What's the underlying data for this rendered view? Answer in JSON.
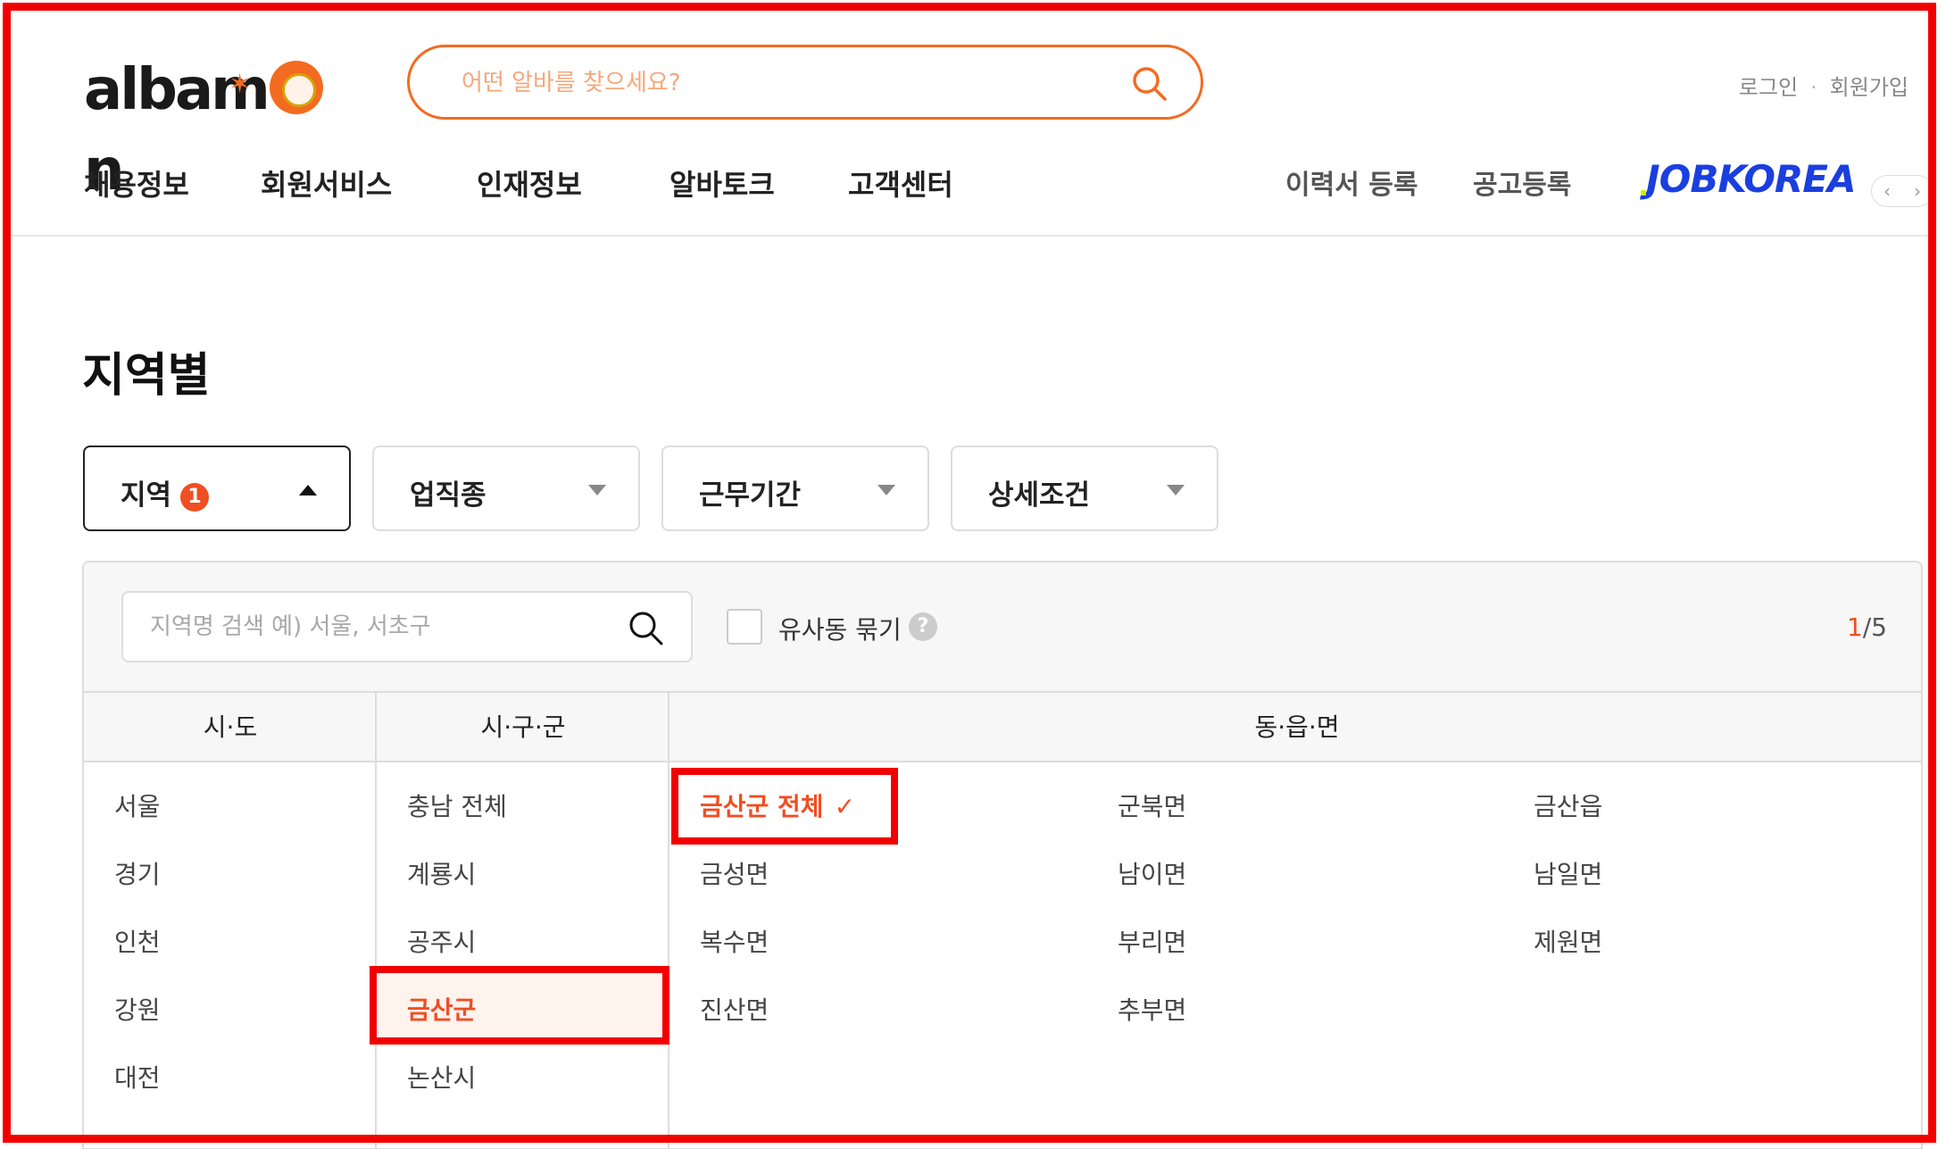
{
  "header": {
    "logo_text": "albamon",
    "search_placeholder": "어떤 알바를 찾으세요?",
    "auth": {
      "login": "로그인",
      "separator": "·",
      "signup": "회원가입"
    },
    "nav": [
      "채용정보",
      "회원서비스",
      "인재정보",
      "알바토크",
      "고객센터"
    ],
    "util": {
      "resume": "이력서 등록",
      "post": "공고등록"
    },
    "partner_logo": "JOBKOREA",
    "carousel": {
      "prev": "‹",
      "next": "›"
    }
  },
  "page_title": "지역별",
  "filters": [
    {
      "label": "지역",
      "badge": "1",
      "state": "open"
    },
    {
      "label": "업직종",
      "state": "closed"
    },
    {
      "label": "근무기간",
      "state": "closed"
    },
    {
      "label": "상세조건",
      "state": "closed"
    }
  ],
  "panel": {
    "search_placeholder": "지역명 검색 예) 서울, 서초구",
    "merge_label": "유사동 묶기",
    "help": "?",
    "counter_current": "1",
    "counter_total": "/5",
    "columns": {
      "sido": "시·도",
      "sigungu": "시·구·군",
      "dong": "동·읍·면"
    },
    "sido": [
      "서울",
      "경기",
      "인천",
      "강원",
      "대전"
    ],
    "sigungu": [
      "충남 전체",
      "계룡시",
      "공주시",
      "금산군",
      "논산시"
    ],
    "sigungu_selected": "금산군",
    "dong_col1": [
      "금산군 전체",
      "금성면",
      "복수면",
      "진산면"
    ],
    "dong_col2": [
      "군북면",
      "남이면",
      "부리면",
      "추부면"
    ],
    "dong_col3": [
      "금산읍",
      "남일면",
      "제원면"
    ],
    "dong_selected": "금산군 전체",
    "check_symbol": "✓"
  },
  "colors": {
    "accent": "#f04e23",
    "brand": "#f36b21",
    "annotation": "#f20000"
  }
}
